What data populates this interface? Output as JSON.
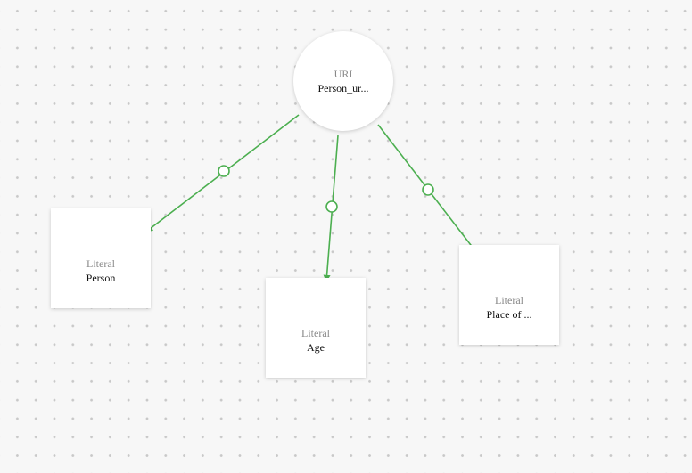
{
  "graph": {
    "root": {
      "type": "URI",
      "label": "Person_ur..."
    },
    "literals": [
      {
        "type": "Literal",
        "label": "Person"
      },
      {
        "type": "Literal",
        "label": "Age"
      },
      {
        "type": "Literal",
        "label": "Place of ..."
      }
    ],
    "edge_color": "#4caf50"
  }
}
